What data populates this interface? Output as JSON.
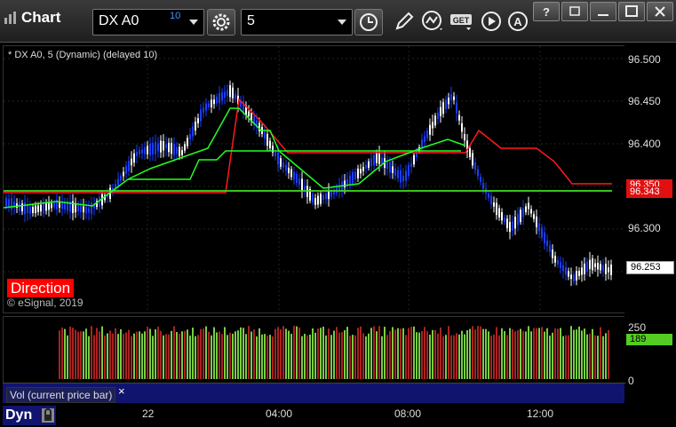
{
  "window": {
    "title": "Chart",
    "symbol": "DX A0",
    "delay_badge": "10",
    "interval": "5",
    "toolbar_icons": [
      "gear-icon",
      "clock-icon",
      "pencil-icon",
      "study-icon",
      "get-icon",
      "play-icon",
      "alert-icon"
    ],
    "window_buttons": [
      "?",
      "restore",
      "minimize",
      "maximize",
      "close"
    ]
  },
  "chart": {
    "label": "* DX A0, 5 (Dynamic) (delayed 10)",
    "direction_label": "Direction",
    "copyright": "© eSignal, 2019",
    "price_ticks": [
      "96.500",
      "96.450",
      "96.400",
      "96.350",
      "96.300"
    ],
    "current_price": "96.253",
    "red_level": "96.350",
    "green_level": "96.343",
    "time_ticks": [
      "22",
      "04:00",
      "08:00",
      "12:00"
    ],
    "vol_ticks": [
      "250",
      "0"
    ],
    "vol_current": "189",
    "vol_label": "Vol (current price bar)",
    "vol_close": "×",
    "dyn_label": "Dyn",
    "colors": {
      "up": "#ffffff",
      "down": "#1a3dff",
      "red": "#ff1a1a",
      "green": "#22ff22",
      "vol_up": "#77cc44",
      "vol_down": "#aa2222"
    }
  }
}
